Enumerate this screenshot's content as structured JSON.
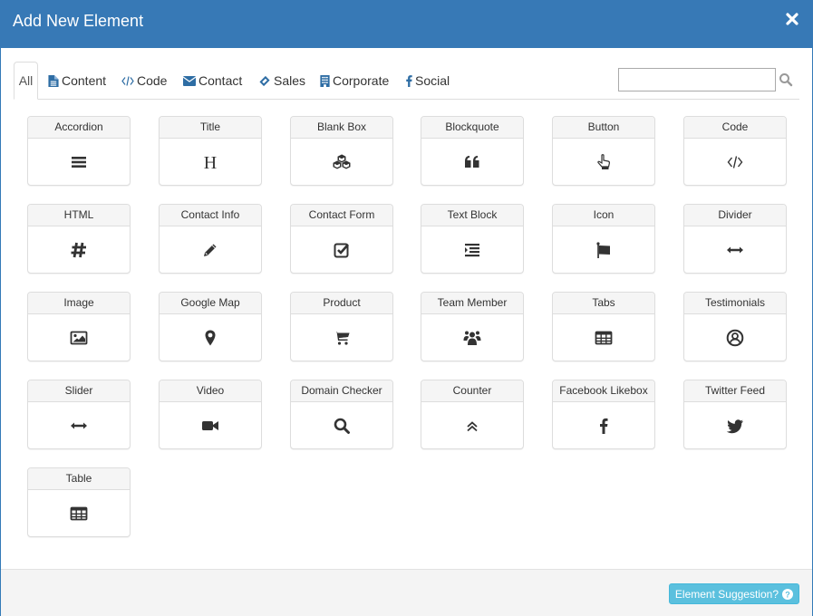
{
  "modal": {
    "title": "Add New Element",
    "close_icon": "close-icon"
  },
  "tabs": [
    {
      "label": "All",
      "icon": "",
      "active": true
    },
    {
      "label": "Content",
      "icon": "file-text-icon",
      "active": false
    },
    {
      "label": "Code",
      "icon": "code-icon",
      "active": false
    },
    {
      "label": "Contact",
      "icon": "envelope-icon",
      "active": false
    },
    {
      "label": "Sales",
      "icon": "ticket-icon",
      "active": false
    },
    {
      "label": "Corporate",
      "icon": "building-icon",
      "active": false
    },
    {
      "label": "Social",
      "icon": "facebook-icon",
      "active": false
    }
  ],
  "search": {
    "value": "",
    "placeholder": "",
    "icon": "search-icon"
  },
  "elements": [
    {
      "label": "Accordion",
      "icon": "bars-icon"
    },
    {
      "label": "Title",
      "icon": "header-icon"
    },
    {
      "label": "Blank Box",
      "icon": "cubes-icon"
    },
    {
      "label": "Blockquote",
      "icon": "quote-left-icon"
    },
    {
      "label": "Button",
      "icon": "hand-pointer-icon"
    },
    {
      "label": "Code",
      "icon": "code-icon"
    },
    {
      "label": "HTML",
      "icon": "hashtag-icon"
    },
    {
      "label": "Contact Info",
      "icon": "pencil-icon"
    },
    {
      "label": "Contact Form",
      "icon": "check-square-icon"
    },
    {
      "label": "Text Block",
      "icon": "indent-icon"
    },
    {
      "label": "Icon",
      "icon": "flag-icon"
    },
    {
      "label": "Divider",
      "icon": "arrows-h-icon"
    },
    {
      "label": "Image",
      "icon": "image-icon"
    },
    {
      "label": "Google Map",
      "icon": "map-marker-icon"
    },
    {
      "label": "Product",
      "icon": "shopping-cart-icon"
    },
    {
      "label": "Team Member",
      "icon": "users-icon"
    },
    {
      "label": "Tabs",
      "icon": "table-icon"
    },
    {
      "label": "Testimonials",
      "icon": "user-circle-icon"
    },
    {
      "label": "Slider",
      "icon": "arrows-h-icon"
    },
    {
      "label": "Video",
      "icon": "video-camera-icon"
    },
    {
      "label": "Domain Checker",
      "icon": "search-icon"
    },
    {
      "label": "Counter",
      "icon": "angle-double-up-icon"
    },
    {
      "label": "Facebook Likebox",
      "icon": "facebook-icon"
    },
    {
      "label": "Twitter Feed",
      "icon": "twitter-icon"
    },
    {
      "label": "Table",
      "icon": "table-icon"
    }
  ],
  "footer": {
    "suggest_label": "Element Suggestion?",
    "suggest_icon": "question-circle-icon"
  },
  "colors": {
    "header_bg": "#3779b6",
    "info_button": "#5bc0de",
    "footer_bg": "#f4f4f4"
  }
}
